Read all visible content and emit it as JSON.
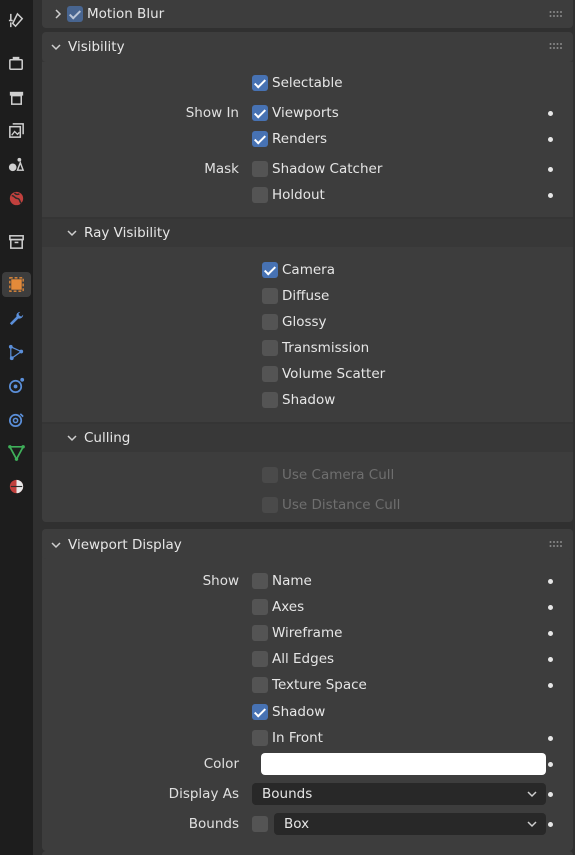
{
  "top_panel": {
    "title": "Motion Blur",
    "checked": true
  },
  "visibility": {
    "title": "Visibility",
    "selectable": "Selectable",
    "show_in_label": "Show In",
    "viewports": "Viewports",
    "renders": "Renders",
    "mask_label": "Mask",
    "shadow_catcher": "Shadow Catcher",
    "holdout": "Holdout"
  },
  "ray_visibility": {
    "title": "Ray Visibility",
    "camera": "Camera",
    "diffuse": "Diffuse",
    "glossy": "Glossy",
    "transmission": "Transmission",
    "volume_scatter": "Volume Scatter",
    "shadow": "Shadow"
  },
  "culling": {
    "title": "Culling",
    "use_camera_cull": "Use Camera Cull",
    "use_distance_cull": "Use Distance Cull"
  },
  "viewport_display": {
    "title": "Viewport Display",
    "show_label": "Show",
    "name": "Name",
    "axes": "Axes",
    "wireframe": "Wireframe",
    "all_edges": "All Edges",
    "texture_space": "Texture Space",
    "shadow": "Shadow",
    "in_front": "In Front",
    "color_label": "Color",
    "color_value": "#ffffff",
    "display_as_label": "Display As",
    "display_as_value": "Bounds",
    "bounds_label": "Bounds",
    "bounds_value": "Box"
  },
  "colors": {
    "accent": "#4772b3",
    "panel": "#3d3d3d",
    "background": "#303030",
    "tabbar": "#1d1d1d"
  },
  "tabs": [
    "tool-icon",
    "render-icon",
    "output-icon",
    "view-layer-icon",
    "scene-icon",
    "world-icon",
    "collection-icon",
    "object-icon",
    "modifier-icon",
    "particles-icon",
    "physics-icon",
    "constraints-icon",
    "data-icon",
    "material-icon"
  ]
}
